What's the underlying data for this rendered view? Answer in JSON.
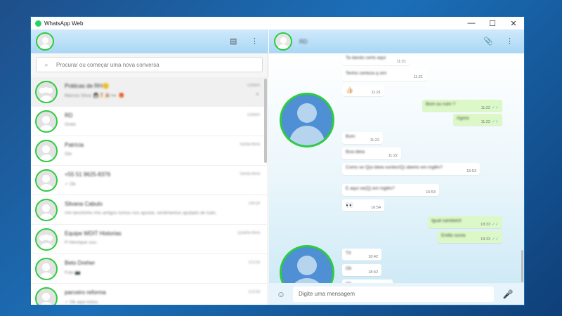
{
  "window": {
    "title": "WhatsApp Web",
    "controls": {
      "minimize": "—",
      "maximize": "☐",
      "close": "✕"
    }
  },
  "left_header": {
    "icons": [
      "new-chat-icon",
      "menu-icon"
    ],
    "new_chat_glyph": "▤",
    "menu_glyph": "⋮"
  },
  "search": {
    "placeholder": "Procurar ou começar uma nova conversa",
    "icon_glyph": "⌕"
  },
  "chats": [
    {
      "name": "Práticas de RH🙂",
      "time": "Ontem",
      "preview": "Marcos Silva: 👩🏻👶🏻🎉 👀 🎁",
      "badge": "4",
      "group": true,
      "active": true
    },
    {
      "name": "RD",
      "time": "Ontem",
      "preview": "Orelo",
      "badge": "",
      "group": false,
      "active": false
    },
    {
      "name": "Patrícia",
      "time": "Sexta-feira",
      "preview": "Oie",
      "badge": "",
      "group": false,
      "active": false
    },
    {
      "name": "+55 51 9625-8376",
      "time": "Sexta-feira",
      "preview": "✓ Ok",
      "badge": "",
      "group": false,
      "active": false
    },
    {
      "name": "Silvana Cabulo",
      "time": "1/6/18",
      "preview": "Um lanchinho mts amigos tomos nos ajustar, sentimentos ajudado de tudo.",
      "badge": "",
      "group": false,
      "active": false
    },
    {
      "name": "Equipe WDIT Historias",
      "time": "Quarta-feira",
      "preview": "P Henrique usu:",
      "badge": "",
      "group": true,
      "active": false
    },
    {
      "name": "Beto Dreher",
      "time": "1/1/18",
      "preview": "Foto 📷",
      "badge": "",
      "group": false,
      "active": false
    },
    {
      "name": "parceiro reforma",
      "time": "1/1/18",
      "preview": "✓ Ok aqui estou",
      "badge": "",
      "group": false,
      "active": false
    }
  ],
  "right_header": {
    "contact_name": "RD",
    "attach_glyph": "📎",
    "menu_glyph": "⋮"
  },
  "messages": [
    {
      "dir": "in",
      "text": "Ta dando certo aqui",
      "time": "11:21"
    },
    {
      "dir": "in",
      "text": "Tenho certeza q sim",
      "time": "11:21"
    },
    {
      "dir": "in",
      "text": "👍🏻",
      "time": "11:21"
    },
    {
      "dir": "out",
      "text": "Bom ou ruim ?",
      "time": "11:22",
      "ticks": "✓✓"
    },
    {
      "dir": "out",
      "text": "Agora",
      "time": "11:22",
      "ticks": "✓✓"
    },
    {
      "dir": "in",
      "text": "Bom",
      "time": "11:22"
    },
    {
      "dir": "in",
      "text": "Boa ideia",
      "time": "11:22"
    },
    {
      "dir": "in",
      "text": "Como se Q(a ideia surdez/Q) aberto em inglês?",
      "time": "16:53"
    },
    {
      "dir": "in",
      "text": "E aqui se(Q) em inglês?",
      "time": "16:53"
    },
    {
      "dir": "in",
      "text": "👀",
      "time": "16:54"
    },
    {
      "dir": "out",
      "text": "Igual sandwich",
      "time": "18:33",
      "ticks": "✓✓"
    },
    {
      "dir": "out",
      "text": "Então ouvia",
      "time": "18:33",
      "ticks": "✓✓"
    },
    {
      "dir": "in",
      "text": "Tô",
      "time": "18:42"
    },
    {
      "dir": "in",
      "text": "Ok",
      "time": "18:42"
    },
    {
      "dir": "in",
      "text": "Ok",
      "time": ""
    }
  ],
  "composer": {
    "placeholder": "Digite uma mensagem",
    "emoji_glyph": "☺",
    "mic_glyph": "🎤"
  },
  "colors": {
    "accent_green": "#2ecc40",
    "header_blue": "#a9d7f5",
    "out_bubble": "#dcf8c6",
    "desktop_blue": "#1b6fb8"
  }
}
